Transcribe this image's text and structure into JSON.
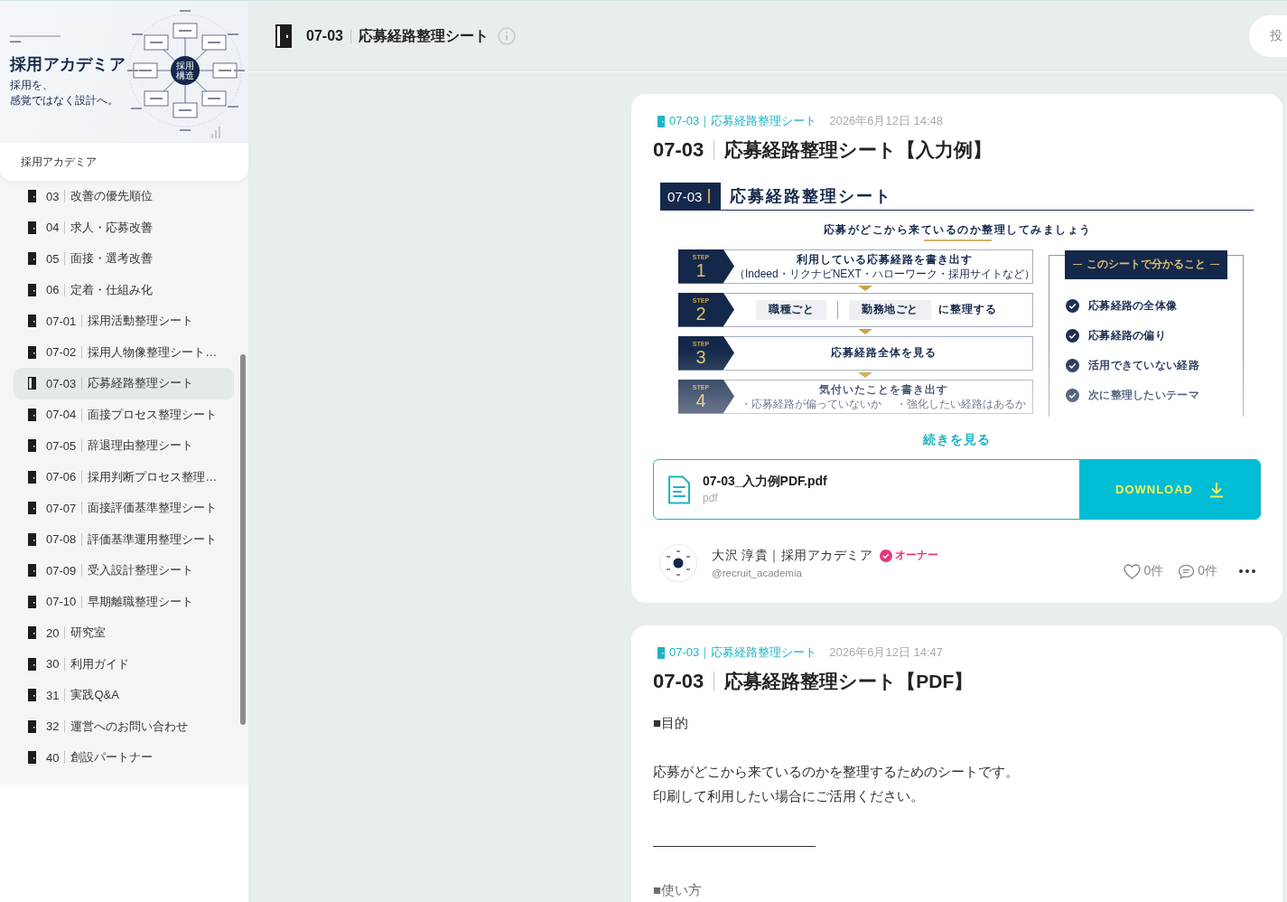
{
  "sidebar": {
    "banner": {
      "title": "採用アカデミア",
      "tagline": [
        "採用を、",
        "感覚ではなく設計へ。"
      ],
      "hub_label": [
        "採用",
        "構造"
      ]
    },
    "community_name": "採用アカデミア",
    "channels": [
      {
        "number": "03",
        "name": "改善の優先順位",
        "selected": false
      },
      {
        "number": "04",
        "name": "求人・応募改善",
        "selected": false
      },
      {
        "number": "05",
        "name": "面接・選考改善",
        "selected": false
      },
      {
        "number": "06",
        "name": "定着・仕組み化",
        "selected": false
      },
      {
        "number": "07-01",
        "name": "採用活動整理シート",
        "selected": false
      },
      {
        "number": "07-02",
        "name": "採用人物像整理シート…",
        "selected": false
      },
      {
        "number": "07-03",
        "name": "応募経路整理シート",
        "selected": true
      },
      {
        "number": "07-04",
        "name": "面接プロセス整理シート",
        "selected": false
      },
      {
        "number": "07-05",
        "name": "辞退理由整理シート",
        "selected": false
      },
      {
        "number": "07-06",
        "name": "採用判断プロセス整理…",
        "selected": false
      },
      {
        "number": "07-07",
        "name": "面接評価基準整理シート",
        "selected": false
      },
      {
        "number": "07-08",
        "name": "評価基準運用整理シート",
        "selected": false
      },
      {
        "number": "07-09",
        "name": "受入設計整理シート",
        "selected": false
      },
      {
        "number": "07-10",
        "name": "早期離職整理シート",
        "selected": false
      },
      {
        "number": "20",
        "name": "研究室",
        "selected": false
      },
      {
        "number": "30",
        "name": "利用ガイド",
        "selected": false
      },
      {
        "number": "31",
        "name": "実践Q&A",
        "selected": false
      },
      {
        "number": "32",
        "name": "運営へのお問い合わせ",
        "selected": false
      },
      {
        "number": "40",
        "name": "創設パートナー",
        "selected": false
      }
    ]
  },
  "header": {
    "number": "07-03",
    "title": "応募経路整理シート",
    "post_button": "投"
  },
  "posts": [
    {
      "channel": "07-03｜応募経路整理シート",
      "date": "2026年6月12日 14:48",
      "number": "07-03",
      "title": "応募経路整理シート【入力例】",
      "preview": {
        "number": "07-03",
        "title": "応募経路整理シート",
        "subtitle": "応募がどこから来ているのか整理してみましょう",
        "steps": [
          {
            "kind": "text",
            "label": "STEP",
            "number": "1",
            "text": "利用している応募経路を書き出す",
            "note": "（Indeed・リクナビNEXT・ハローワーク・採用サイトなど）"
          },
          {
            "kind": "choices",
            "label": "STEP",
            "number": "2",
            "choices": [
              "職種ごと",
              "勤務地ごと"
            ],
            "text": "に整理する"
          },
          {
            "kind": "text",
            "label": "STEP",
            "number": "3",
            "text": "応募経路全体を見る"
          },
          {
            "kind": "bullets",
            "label": "STEP",
            "number": "4",
            "text": "気付いたことを書き出す",
            "bullets": [
              "・応募経路が偏っていないか",
              "・強化したい経路はあるか"
            ]
          }
        ],
        "panel": {
          "title": "このシートで分かること",
          "items": [
            "応募経路の全体像",
            "応募経路の偏り",
            "活用できていない経路",
            "次に整理したいテーマ"
          ]
        }
      },
      "read_more": "続きを見る",
      "attachment": {
        "file_name": "07-03_入力例PDF.pdf",
        "file_type": "pdf",
        "button": "DOWNLOAD"
      },
      "author": {
        "name": "大沢 淳貴｜採用アカデミア",
        "role": "オーナー",
        "handle": "@recruit_academia"
      },
      "likes": "0件",
      "comments": "0件"
    },
    {
      "channel": "07-03｜応募経路整理シート",
      "date": "2026年6月12日 14:47",
      "number": "07-03",
      "title": "応募経路整理シート【PDF】",
      "body": [
        [
          "■目的"
        ],
        [
          "応募がどこから来ているのかを整理するためのシートです。",
          "印刷して利用したい場合にご活用ください。"
        ],
        [
          "————————————"
        ],
        [
          "■使い方"
        ]
      ]
    }
  ]
}
